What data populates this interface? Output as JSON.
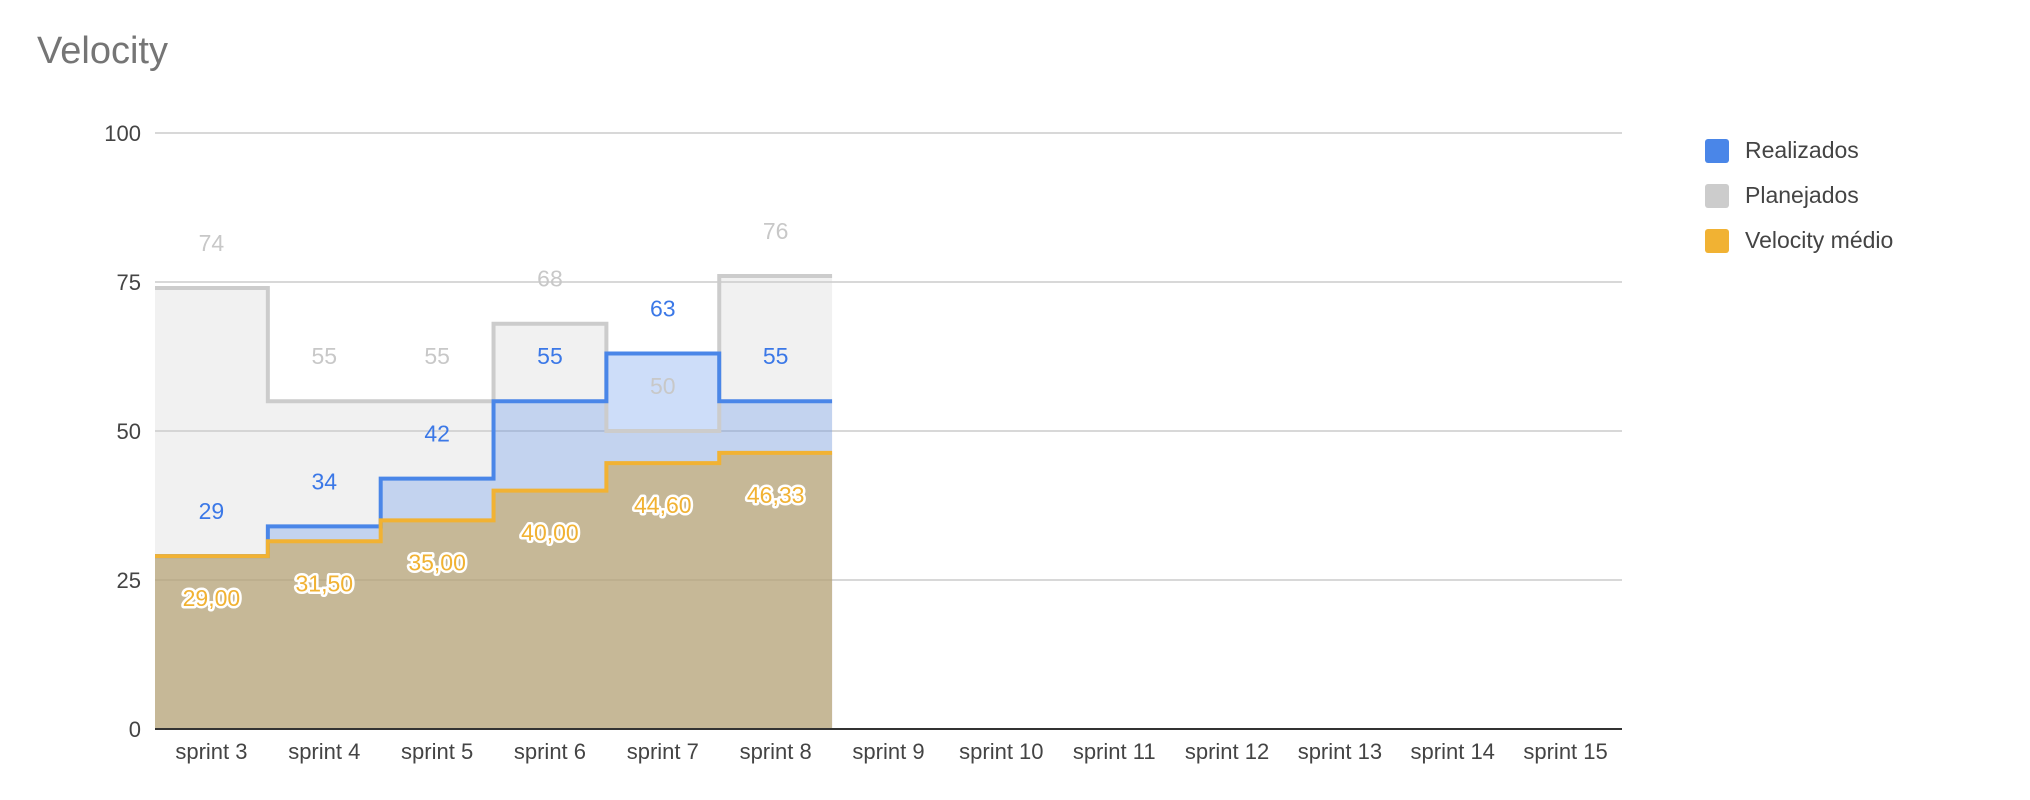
{
  "title": "Velocity",
  "chart_data": {
    "type": "area",
    "title": "Velocity",
    "categories": [
      "sprint 3",
      "sprint 4",
      "sprint 5",
      "sprint 6",
      "sprint 7",
      "sprint 8",
      "sprint 9",
      "sprint 10",
      "sprint 11",
      "sprint 12",
      "sprint 13",
      "sprint 14",
      "sprint 15"
    ],
    "ylim": [
      0,
      100
    ],
    "yticks": [
      "0",
      "25",
      "50",
      "75",
      "100"
    ],
    "grid": true,
    "legend_position": "right",
    "series": [
      {
        "name": "Realizados",
        "color": "#4a86e8",
        "values": [
          29,
          34,
          42,
          55,
          63,
          55,
          null,
          null,
          null,
          null,
          null,
          null,
          null
        ],
        "labels": [
          "29",
          "34",
          "42",
          "55",
          "63",
          "55"
        ]
      },
      {
        "name": "Planejados",
        "color": "#cccccc",
        "values": [
          74,
          55,
          55,
          68,
          50,
          76,
          null,
          null,
          null,
          null,
          null,
          null,
          null
        ],
        "labels": [
          "74",
          "55",
          "55",
          "68",
          "50",
          "76"
        ]
      },
      {
        "name": "Velocity médio",
        "color": "#f1b233",
        "values": [
          29.0,
          31.5,
          35.0,
          40.0,
          44.6,
          46.33,
          null,
          null,
          null,
          null,
          null,
          null,
          null
        ],
        "labels": [
          "29,00",
          "31,50",
          "35,00",
          "40,00",
          "44,60",
          "46,33"
        ]
      }
    ]
  }
}
